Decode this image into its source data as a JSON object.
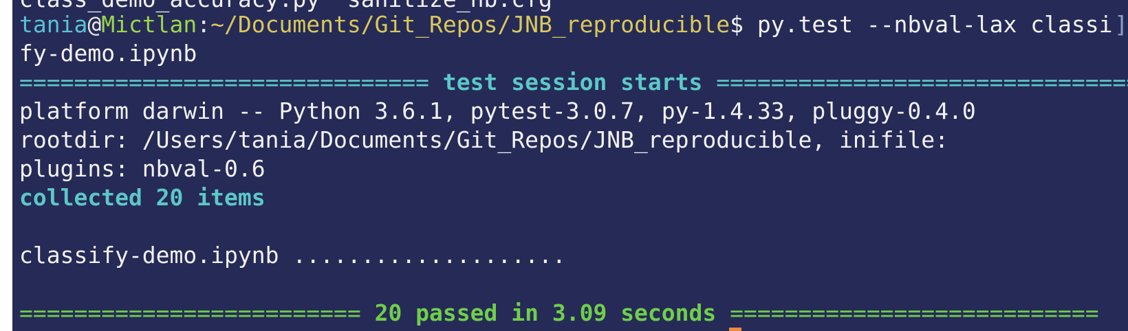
{
  "terminal": {
    "cut_top_line": "class_demo_accuracy.py  sanitize_nb.cfg",
    "prompt": {
      "user": "tania",
      "at": "@",
      "host": "Mictlan",
      "colon": ":",
      "path": "~/Documents/Git_Repos/JNB_reproducible",
      "dollar": "$",
      "command": " py.test --nbval-lax classi"
    },
    "command_wrap": "fy-demo.ipynb",
    "session_header": {
      "left_rule": "==============================",
      "title": " test session starts ",
      "right_rule": "==============================="
    },
    "platform_line": "platform darwin -- Python 3.6.1, pytest-3.0.7, py-1.4.33, pluggy-0.4.0",
    "rootdir_line": "rootdir: /Users/tania/Documents/Git_Repos/JNB_reproducible, inifile:",
    "plugins_line": "plugins: nbval-0.6",
    "collected_line": "collected 20 items",
    "result_line": "classify-demo.ipynb ....................",
    "summary": {
      "left_rule": "=========================",
      "title": " 20 passed in 3.09 seconds ",
      "right_rule": "==========================="
    },
    "colors": {
      "background": "#262a57",
      "cyan": "#5cc8c8",
      "green": "#6fcf4a",
      "path_yellow": "#d9c85a"
    }
  }
}
